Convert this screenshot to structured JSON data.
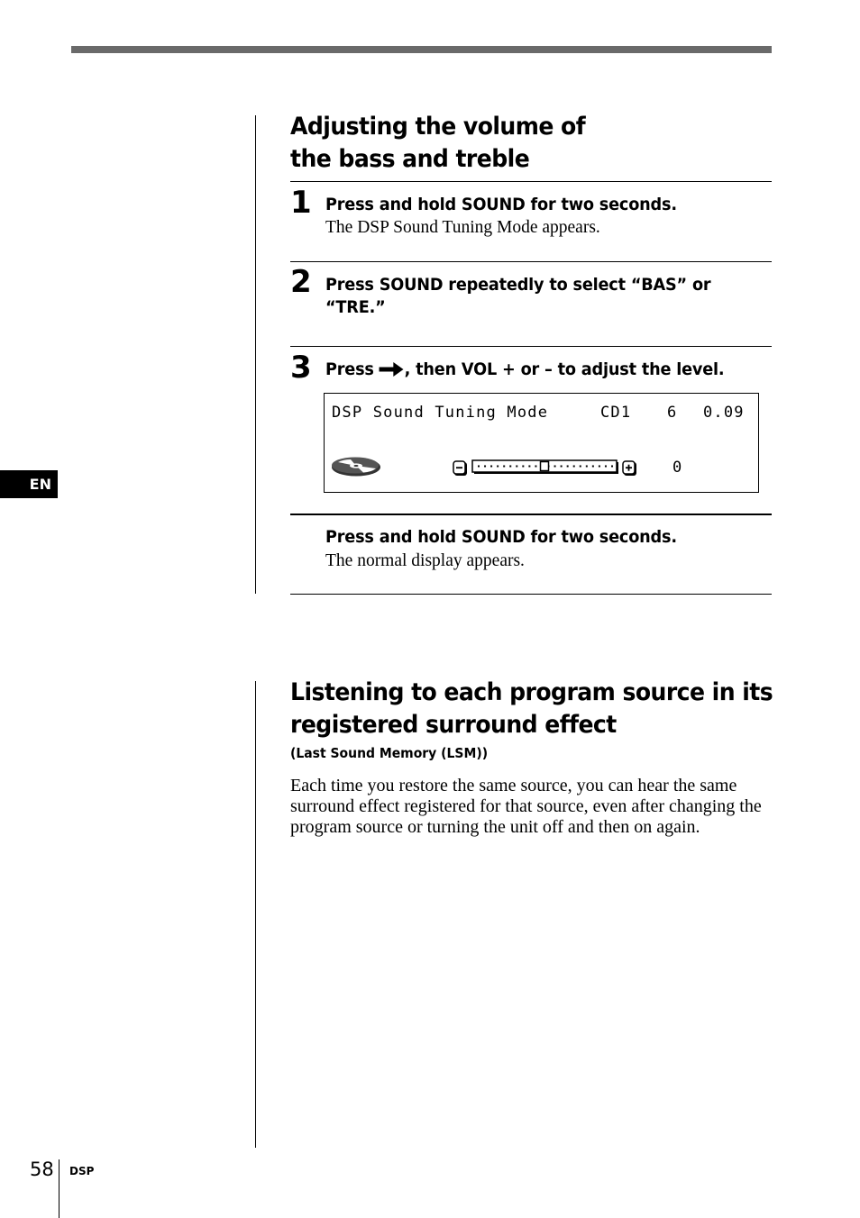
{
  "section1": {
    "title_line1": "Adjusting the volume of",
    "title_line2": "the bass and treble",
    "steps": [
      {
        "number": "1",
        "instruction": "Press and hold SOUND for two seconds.",
        "result": "The DSP Sound Tuning Mode appears."
      },
      {
        "number": "2",
        "instruction_line1": "Press SOUND repeatedly to select “BAS” or",
        "instruction_line2": "“TRE.”"
      },
      {
        "number": "3",
        "instruction_pre": "Press ",
        "arrow_icon": "right-arrow",
        "instruction_post": ", then VOL + or – to adjust the level."
      },
      {
        "number": "",
        "instruction": "Press and hold SOUND for two seconds.",
        "result": "The normal display appears."
      }
    ],
    "display": {
      "mode_label": "DSP Sound Tuning Mode",
      "source": "CD1",
      "track": "6",
      "time": "0.09",
      "disc_icon": "disc-icon",
      "minus_label": "−",
      "plus_label": "+",
      "level_value": "0",
      "slider_position_fraction": 0.5
    }
  },
  "section2": {
    "title_line1": "Listening to each program source in its",
    "title_line2": "registered surround effect",
    "subtitle": "(Last Sound Memory (LSM))",
    "body": "Each time you restore the same source, you can hear the same surround effect registered for that source, even after changing the program source or turning the unit off and then on again."
  },
  "side_tab": {
    "language": "EN"
  },
  "footer": {
    "page_number": "58",
    "section": "DSP"
  }
}
